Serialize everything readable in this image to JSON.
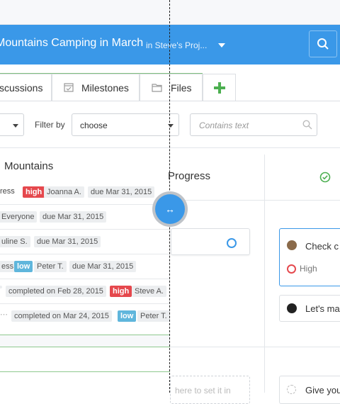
{
  "header": {
    "project_title": "Mountains Camping in March",
    "project_subtitle": "in Steve's Proj...",
    "search_icon": "search-icon"
  },
  "tabs": [
    {
      "label": "scussions",
      "icon": "chat-icon"
    },
    {
      "label": "Milestones",
      "icon": "calendar-check-icon"
    },
    {
      "label": "Files",
      "icon": "folder-icon"
    },
    {
      "label": "+",
      "icon": "plus-icon"
    }
  ],
  "filter": {
    "label": "Filter by",
    "select_value": "choose",
    "search_placeholder": "Contains text"
  },
  "columns": {
    "col1_title": "Mountains",
    "col2_title": "Progress",
    "col3_icon": "check-circle-icon"
  },
  "rows": [
    {
      "t1": "ress",
      "priority": "high",
      "assignee": "Joanna A.",
      "date": "due Mar 31, 2015"
    },
    {
      "t1": "Everyone",
      "date": "due Mar 31, 2015"
    },
    {
      "t1": "uline S.",
      "date": "due Mar 31, 2015"
    },
    {
      "t1": "ess",
      "priority": "low",
      "assignee": "Peter T.",
      "date": "due Mar 31, 2015"
    },
    {
      "t1": "completed on Feb 28, 2015",
      "priority": "high",
      "assignee": "Steve A."
    },
    {
      "t1": "completed on Mar 24, 2015",
      "priority": "low",
      "assignee": "Peter T."
    }
  ],
  "cards": {
    "card_b_text": "Check c",
    "card_b_priority": "High",
    "card_c_text": "Let's ma",
    "card_d_text": "Give you",
    "dropzone_text": "here to set it in"
  },
  "handle": {
    "symbol": "↔"
  },
  "colors": {
    "header": "#3a98e8",
    "high": "#e5484d",
    "low": "#5fb6dc",
    "green": "#4caf50"
  }
}
